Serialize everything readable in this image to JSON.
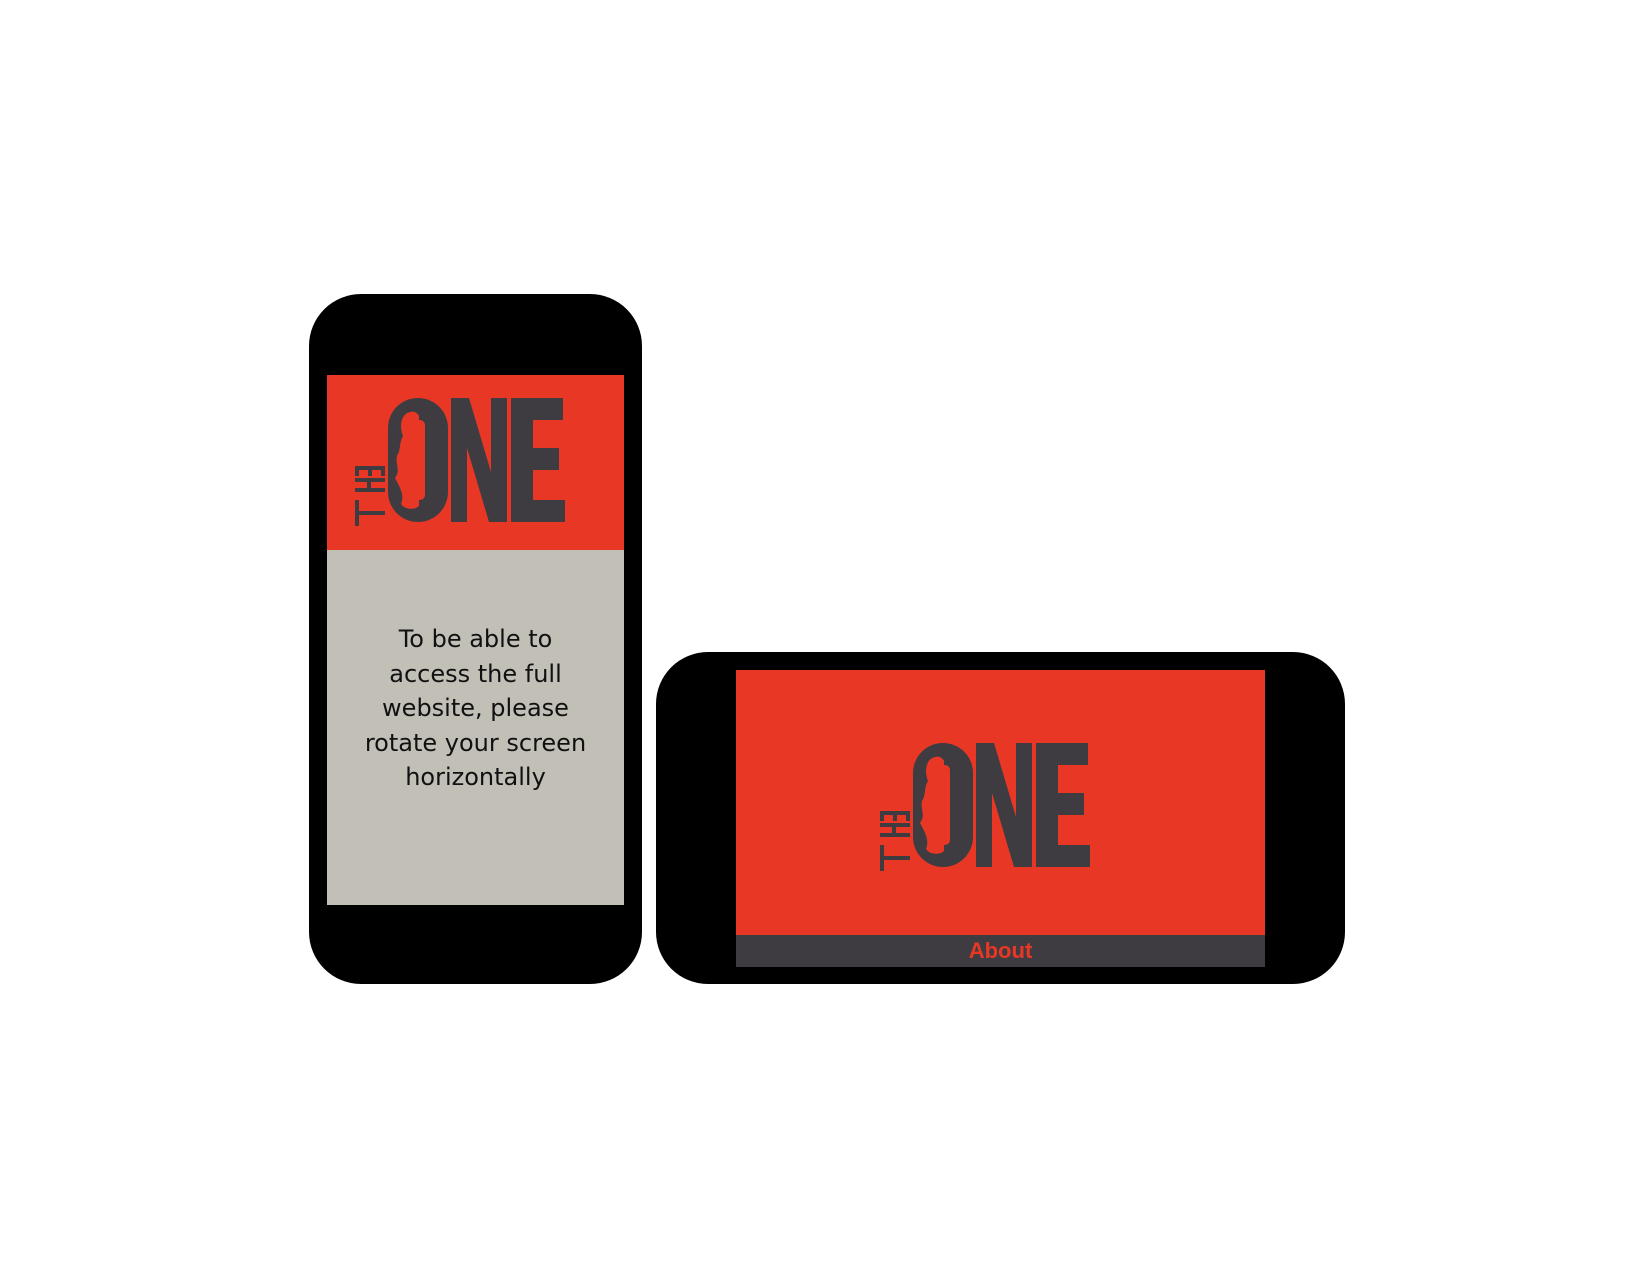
{
  "colors": {
    "brand_red": "#e83825",
    "charcoal": "#3e3c41",
    "device_black": "#000000",
    "message_bg": "#c2bfb7",
    "page_bg": "#ffffff"
  },
  "logo": {
    "small_word": "THE",
    "main_word": "ONE",
    "icon": "woman-silhouette-icon"
  },
  "portrait": {
    "message_lines": [
      "To be able to",
      "access the full",
      "website, please",
      "rotate your screen",
      "horizontally"
    ]
  },
  "landscape": {
    "nav": {
      "about_label": "About"
    }
  }
}
